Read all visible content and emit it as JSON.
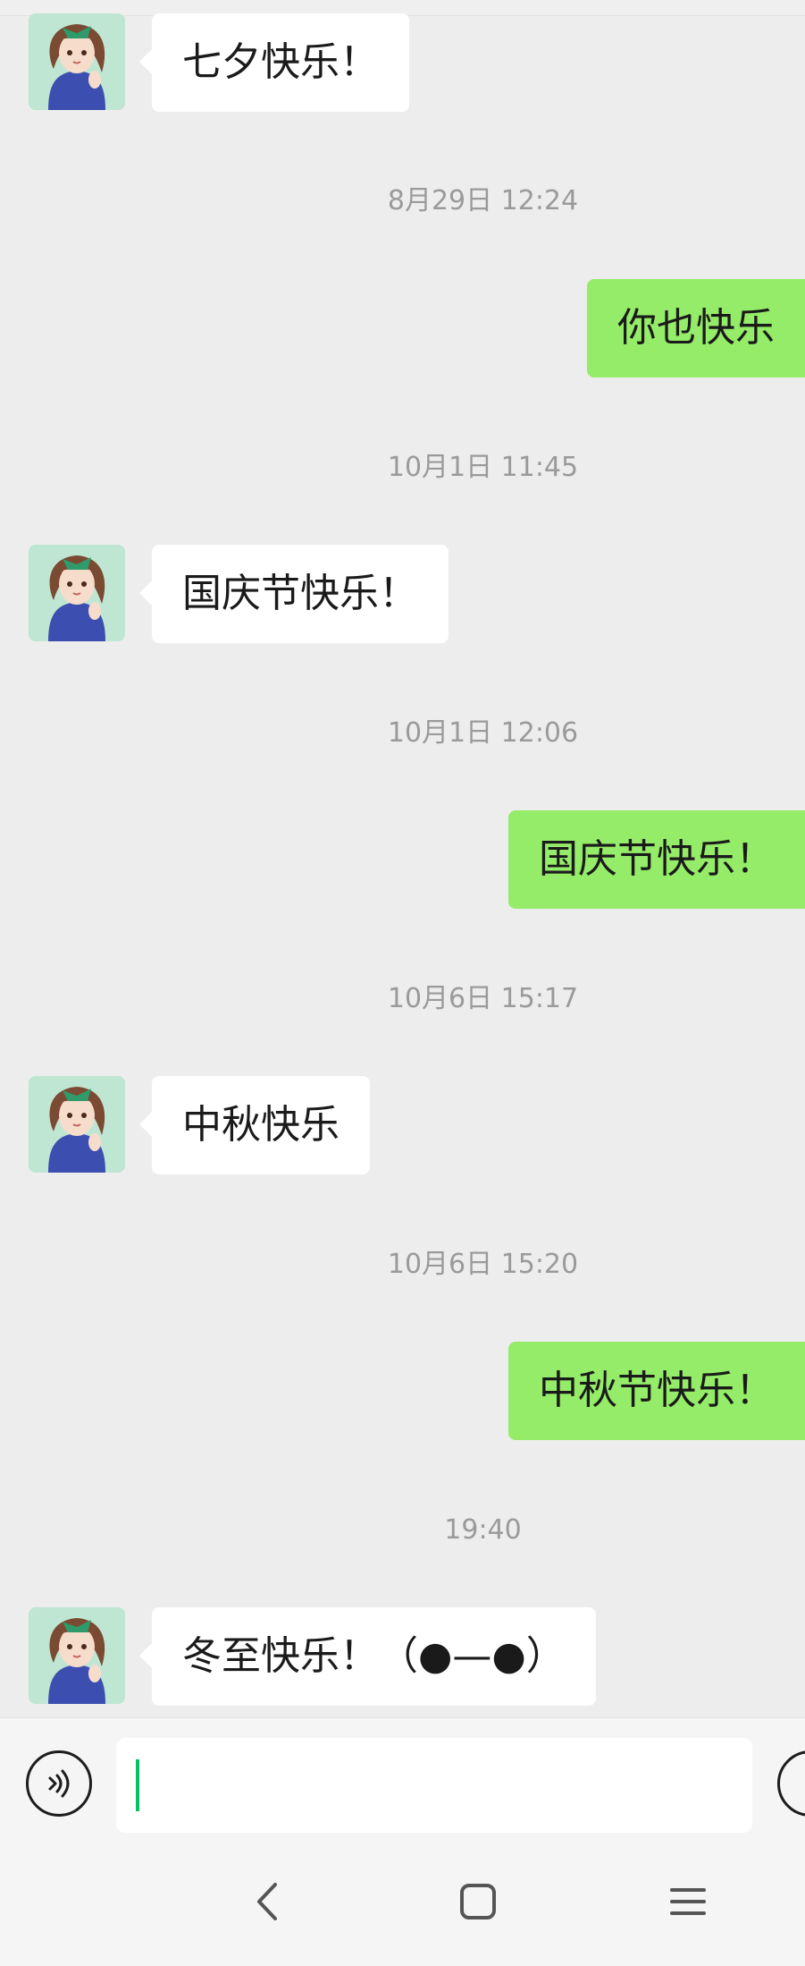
{
  "chat": {
    "messages": [
      {
        "type": "incoming",
        "text": "七夕快乐！"
      },
      {
        "type": "time",
        "text": "8月29日 12:24"
      },
      {
        "type": "outgoing",
        "text": "你也快乐"
      },
      {
        "type": "time",
        "text": "10月1日 11:45"
      },
      {
        "type": "incoming",
        "text": "国庆节快乐！"
      },
      {
        "type": "time",
        "text": "10月1日 12:06"
      },
      {
        "type": "outgoing",
        "text": "国庆节快乐！"
      },
      {
        "type": "time",
        "text": "10月6日 15:17"
      },
      {
        "type": "incoming",
        "text": "中秋快乐"
      },
      {
        "type": "time",
        "text": "10月6日 15:20"
      },
      {
        "type": "outgoing",
        "text": "中秋节快乐！"
      },
      {
        "type": "time",
        "text": "19:40"
      },
      {
        "type": "incoming",
        "text": "冬至快乐！（●—●）"
      }
    ]
  },
  "input": {
    "value": "",
    "voice_icon": "voice-icon",
    "emoji_icon": "emoji-icon"
  },
  "nav": {
    "back_icon": "back-icon",
    "home_icon": "home-icon",
    "menu_icon": "menu-icon"
  },
  "colors": {
    "background": "#ededed",
    "incoming_bubble": "#ffffff",
    "outgoing_bubble": "#95ec69",
    "caret": "#07c160"
  }
}
